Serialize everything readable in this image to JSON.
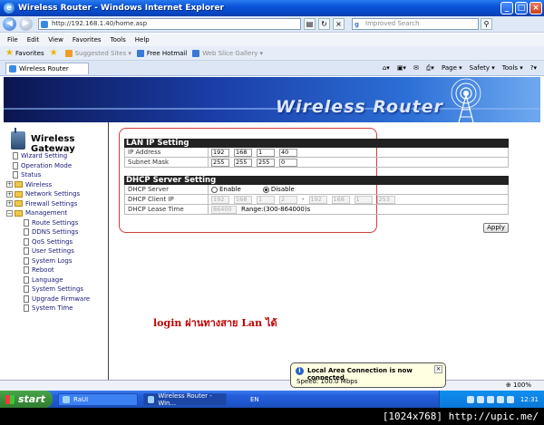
{
  "window": {
    "title": "Wireless Router - Windows Internet Explorer"
  },
  "address_bar": {
    "url": "http://192.168.1.40/home.asp",
    "search_placeholder": "Improved Search"
  },
  "menu": [
    "File",
    "Edit",
    "View",
    "Favorites",
    "Tools",
    "Help"
  ],
  "favorites_bar": {
    "favorites_label": "Favorites",
    "links": [
      "Suggested Sites ▾",
      "Free Hotmail",
      "Web Slice Gallery ▾"
    ]
  },
  "tab": {
    "label": "Wireless Router"
  },
  "command_bar": [
    "Page ▾",
    "Safety ▾",
    "Tools ▾"
  ],
  "banner": {
    "brand": "Wireless Router"
  },
  "sidebar": {
    "title": "Wireless Gateway",
    "items": [
      {
        "label": "Wizard Setting",
        "type": "page",
        "level": 0
      },
      {
        "label": "Operation Mode",
        "type": "page",
        "level": 0
      },
      {
        "label": "Status",
        "type": "page",
        "level": 0
      },
      {
        "label": "Wireless",
        "type": "folder",
        "level": 0
      },
      {
        "label": "Network Settings",
        "type": "folder",
        "level": 0
      },
      {
        "label": "Firewall Settings",
        "type": "folder",
        "level": 0
      },
      {
        "label": "Management",
        "type": "folder-open",
        "level": 0
      },
      {
        "label": "Route Settings",
        "type": "page",
        "level": 1
      },
      {
        "label": "DDNS Settings",
        "type": "page",
        "level": 1
      },
      {
        "label": "QoS Settings",
        "type": "page",
        "level": 1
      },
      {
        "label": "User Settings",
        "type": "page",
        "level": 1
      },
      {
        "label": "System Logs",
        "type": "page",
        "level": 1
      },
      {
        "label": "Reboot",
        "type": "page",
        "level": 1
      },
      {
        "label": "Language",
        "type": "page",
        "level": 1
      },
      {
        "label": "System Settings",
        "type": "page",
        "level": 1
      },
      {
        "label": "Upgrade Firmware",
        "type": "page",
        "level": 1
      },
      {
        "label": "System Time",
        "type": "page",
        "level": 1
      }
    ]
  },
  "lan": {
    "section_title": "LAN IP Setting",
    "ip_label": "IP Address",
    "ip": [
      "192",
      "168",
      "1",
      "40"
    ],
    "mask_label": "Subnet Mask",
    "mask": [
      "255",
      "255",
      "255",
      "0"
    ]
  },
  "dhcp": {
    "section_title": "DHCP Server Setting",
    "server_label": "DHCP Server",
    "enable_label": "Enable",
    "disable_label": "Disable",
    "selected": "Disable",
    "client_ip_label": "DHCP Client IP",
    "start_ip": [
      "192",
      "168",
      "1",
      "2"
    ],
    "end_ip": [
      "192",
      "168",
      "1",
      "253"
    ],
    "lease_label": "DHCP Lease Time",
    "lease_value": "86400",
    "lease_range": "Range:(300-864000)s"
  },
  "apply_label": "Apply",
  "annotation_text": "login ผ่านทางสาย Lan ได้",
  "status_bar": {
    "zoom": "⊕ 100%"
  },
  "balloon": {
    "title": "Local Area Connection is now connected",
    "subtitle": "Speed: 100.0 Mbps"
  },
  "taskbar": {
    "start_label": "start",
    "tasks": [
      "RaUI",
      "Wireless Router - Win..."
    ],
    "language": "EN",
    "clock": "12:31"
  },
  "watermark": "[1024x768] http://upic.me/",
  "colors": {
    "banner_dark": "#0b1650",
    "banner_light": "#6fa9ef",
    "annotation_box": "#d23b3b",
    "annotation_text": "#c00000",
    "xp_taskbar": "#245edb",
    "xp_start": "#3a8f3a"
  }
}
